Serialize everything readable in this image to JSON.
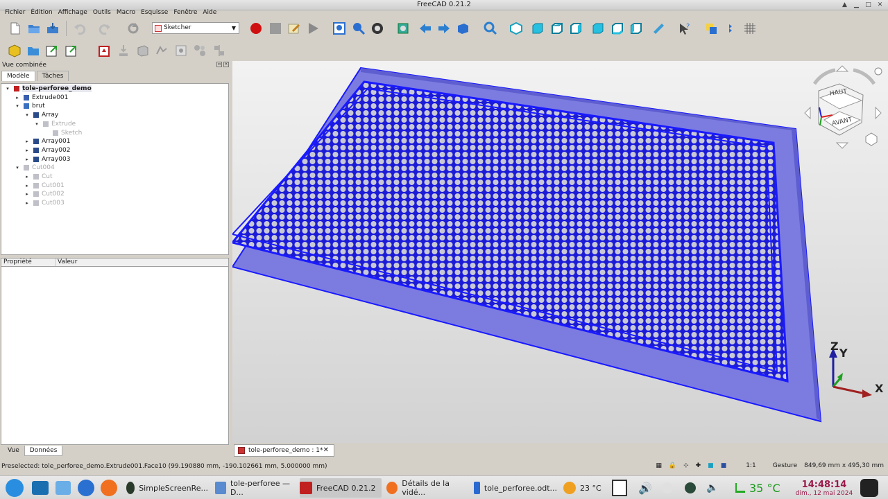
{
  "window": {
    "title": "FreeCAD 0.21.2"
  },
  "menu": [
    "Fichier",
    "Édition",
    "Affichage",
    "Outils",
    "Macro",
    "Esquisse",
    "Fenêtre",
    "Aide"
  ],
  "workbench": {
    "selected": "Sketcher"
  },
  "combo": {
    "title": "Vue combinée",
    "tabs": [
      "Modèle",
      "Tâches"
    ],
    "bottom_tabs": [
      "Vue",
      "Données"
    ]
  },
  "tree": [
    {
      "label": "tole-perforee_demo",
      "icon": "document-icon",
      "depth": 0,
      "expanded": true,
      "dim": false,
      "sel": true
    },
    {
      "label": "Extrude001",
      "icon": "extrude-icon",
      "depth": 1,
      "expanded": false,
      "dim": false,
      "sel": false
    },
    {
      "label": "brut",
      "icon": "folder-icon",
      "depth": 1,
      "expanded": true,
      "dim": false,
      "sel": false
    },
    {
      "label": "Array",
      "icon": "array-icon",
      "depth": 2,
      "expanded": true,
      "dim": false,
      "sel": false
    },
    {
      "label": "Extrude",
      "icon": "extrude-icon",
      "depth": 3,
      "expanded": true,
      "dim": true,
      "sel": false
    },
    {
      "label": "Sketch",
      "icon": "sketch-icon",
      "depth": 4,
      "expanded": null,
      "dim": true,
      "sel": false
    },
    {
      "label": "Array001",
      "icon": "array-icon",
      "depth": 2,
      "expanded": false,
      "dim": false,
      "sel": false
    },
    {
      "label": "Array002",
      "icon": "array-icon",
      "depth": 2,
      "expanded": false,
      "dim": false,
      "sel": false
    },
    {
      "label": "Array003",
      "icon": "array-icon",
      "depth": 2,
      "expanded": false,
      "dim": false,
      "sel": false
    },
    {
      "label": "Cut004",
      "icon": "folder-icon",
      "depth": 1,
      "expanded": true,
      "dim": true,
      "sel": false
    },
    {
      "label": "Cut",
      "icon": "cut-icon",
      "depth": 2,
      "expanded": false,
      "dim": true,
      "sel": false
    },
    {
      "label": "Cut001",
      "icon": "cut-icon",
      "depth": 2,
      "expanded": false,
      "dim": true,
      "sel": false
    },
    {
      "label": "Cut002",
      "icon": "cut-icon",
      "depth": 2,
      "expanded": false,
      "dim": true,
      "sel": false
    },
    {
      "label": "Cut003",
      "icon": "cut-icon",
      "depth": 2,
      "expanded": false,
      "dim": true,
      "sel": false
    }
  ],
  "properties": {
    "col_property": "Propriété",
    "col_value": "Valeur"
  },
  "navcube": {
    "top": "HAUT",
    "front": "AVANT"
  },
  "axes": {
    "x": "X",
    "y": "Y",
    "z": "Z"
  },
  "doc_tab": {
    "label": "tole-perforee_demo : 1*"
  },
  "status": {
    "text": "Preselected: tole_perforee_demo.Extrude001.Face10 (99.190880 mm, -190.102661 mm, 5.000000 mm)",
    "scale": "1:1",
    "nav_style": "Gesture",
    "dimensions": "849,69 mm x 495,30 mm"
  },
  "taskbar": {
    "apps": [
      "SimpleScreenRe...",
      "tole-perforee — D...",
      "FreeCAD 0.21.2",
      "Détails de la vidé...",
      "tole_perforee.odt..."
    ],
    "weather": "23 °C",
    "temperature": "35 °C",
    "time": "14:48:14",
    "date": "dim., 12 mai 2024"
  },
  "colors": {
    "accent": "#1a1aff",
    "plate_fill": "#7f7fe0",
    "hole_fill": "#c8c8d8"
  }
}
